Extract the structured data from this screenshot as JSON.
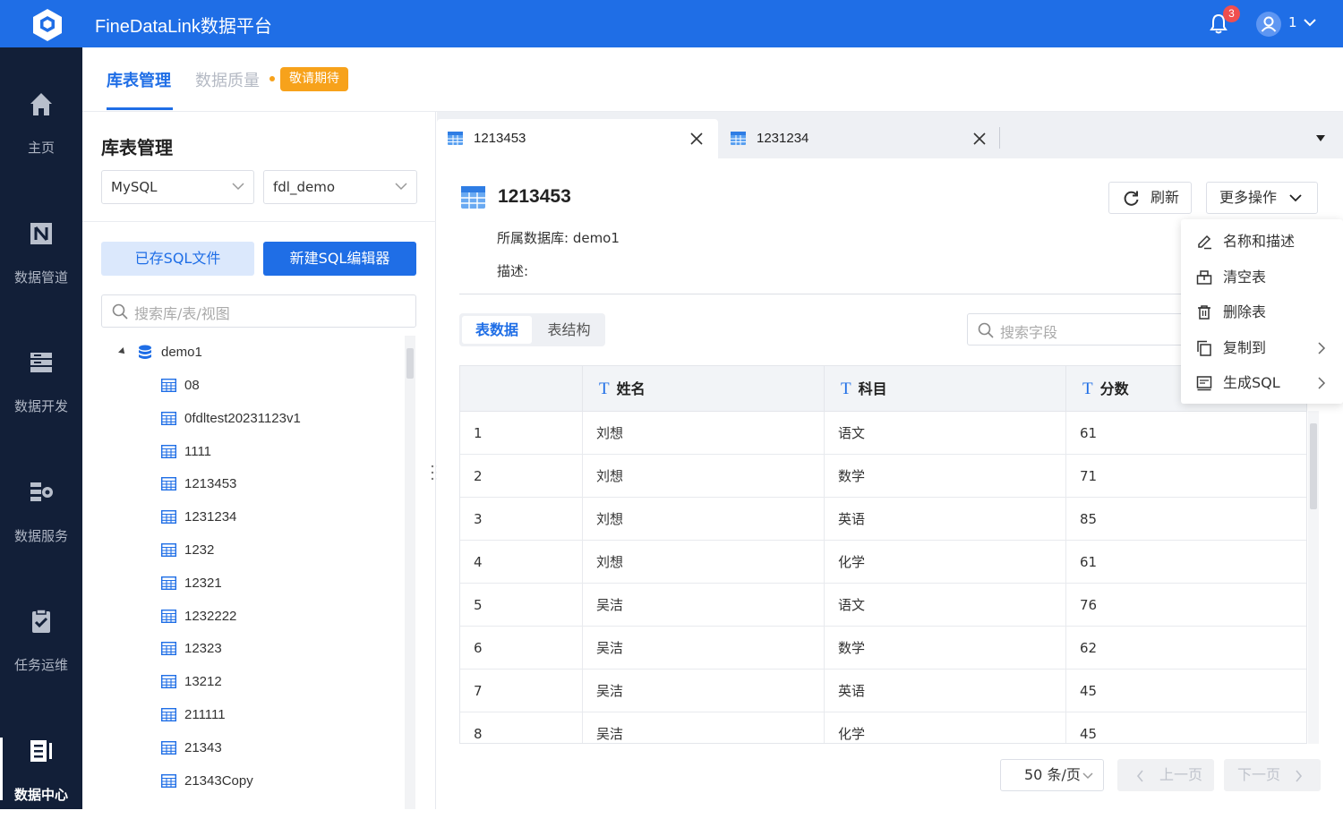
{
  "app": {
    "title": "FineDataLink数据平台",
    "notification_count": "3",
    "user_name": "1"
  },
  "sidenav": [
    {
      "label": "主页",
      "icon": "home-icon"
    },
    {
      "label": "数据管道",
      "icon": "pipeline-icon"
    },
    {
      "label": "数据开发",
      "icon": "dev-icon"
    },
    {
      "label": "数据服务",
      "icon": "service-icon"
    },
    {
      "label": "任务运维",
      "icon": "ops-icon"
    },
    {
      "label": "数据中心",
      "icon": "datacenter-icon",
      "active": true
    }
  ],
  "section_tabs": {
    "active": "库表管理",
    "inactive": "数据质量",
    "coming_soon": "敬请期待"
  },
  "left_panel": {
    "title": "库表管理",
    "db_type": "MySQL",
    "db_name": "fdl_demo",
    "saved_sql_button": "已存SQL文件",
    "new_sql_button": "新建SQL编辑器",
    "search_placeholder": "搜索库/表/视图",
    "tree_root": "demo1",
    "tables": [
      "08",
      "0fdltest20231123v1",
      "1111",
      "1213453",
      "1231234",
      "1232",
      "12321",
      "1232222",
      "12323",
      "13212",
      "211111",
      "21343",
      "21343Copy"
    ]
  },
  "tabs": [
    {
      "label": "1213453",
      "active": true
    },
    {
      "label": "1231234",
      "active": false
    }
  ],
  "detail": {
    "table_name": "1213453",
    "database_label": "所属数据库: demo1",
    "description_label": "描述:",
    "refresh_button": "刷新",
    "more_ops_button": "更多操作",
    "view_tabs": {
      "data": "表数据",
      "structure": "表结构"
    },
    "field_search_placeholder": "搜索字段"
  },
  "more_menu": [
    {
      "label": "名称和描述",
      "icon": "edit-icon",
      "submenu": false
    },
    {
      "label": "清空表",
      "icon": "clear-table-icon",
      "submenu": false
    },
    {
      "label": "删除表",
      "icon": "trash-icon",
      "submenu": false
    },
    {
      "label": "复制到",
      "icon": "copy-icon",
      "submenu": true
    },
    {
      "label": "生成SQL",
      "icon": "sql-icon",
      "submenu": true
    }
  ],
  "grid": {
    "columns": [
      "姓名",
      "科目",
      "分数"
    ],
    "rows": [
      [
        "1",
        "刘想",
        "语文",
        "61"
      ],
      [
        "2",
        "刘想",
        "数学",
        "71"
      ],
      [
        "3",
        "刘想",
        "英语",
        "85"
      ],
      [
        "4",
        "刘想",
        "化学",
        "61"
      ],
      [
        "5",
        "吴洁",
        "语文",
        "76"
      ],
      [
        "6",
        "吴洁",
        "数学",
        "62"
      ],
      [
        "7",
        "吴洁",
        "英语",
        "45"
      ],
      [
        "8",
        "吴洁",
        "化学",
        "45"
      ]
    ]
  },
  "pagination": {
    "page_size": "50 条/页",
    "prev": "上一页",
    "next": "下一页"
  },
  "colors": {
    "primary": "#1f6ee6",
    "nav_bg": "#121f38",
    "badge": "#f04e4e",
    "coming_soon": "#f7a21b"
  }
}
